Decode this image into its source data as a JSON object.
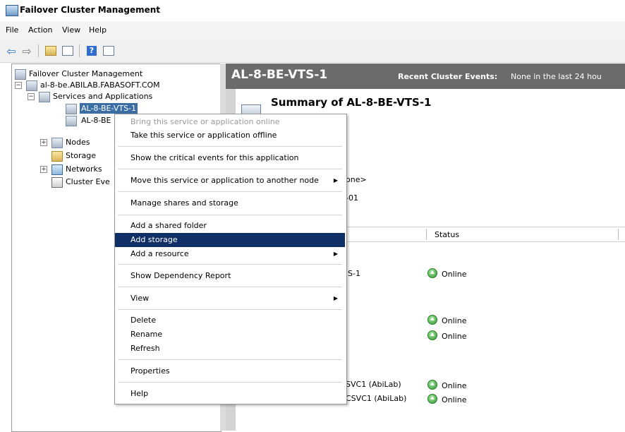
{
  "window": {
    "title": "Failover Cluster Management"
  },
  "menubar": [
    "File",
    "Action",
    "View",
    "Help"
  ],
  "toolbar": {
    "icons": [
      "back-icon",
      "forward-icon",
      "up-icon",
      "show-hide-tree-icon",
      "help-icon",
      "properties-icon"
    ]
  },
  "tree": {
    "root": "Failover Cluster Management",
    "cluster": "al-8-be.ABILAB.FABASOFT.COM",
    "services": "Services and Applications",
    "service_1": "AL-8-BE-VTS-1",
    "service_2": "AL-8-BE",
    "nodes": "Nodes",
    "storage": "Storage",
    "networks": "Networks",
    "events": "Cluster Eve"
  },
  "right": {
    "header_title": "AL-8-BE-VTS-1",
    "recent_label": "Recent Cluster Events:",
    "recent_value": "None in the last 24 hou",
    "summary_title": "Summary of AL-8-BE-VTS-1",
    "frag_none": "one>",
    "frag_01": "-01",
    "col_status": "Status",
    "row1_name": "'S-1",
    "row1_status": "Online",
    "row2_status": "Online",
    "row3_status": "Online",
    "row4_name": "SVC1 (AbiLab)",
    "row4_status": "Online",
    "row5_name": "CSVC1 (AbiLab)",
    "row5_status": "Online"
  },
  "context_menu": [
    {
      "label": "Bring this service or application online",
      "disabled": true
    },
    {
      "label": "Take this service or application offline"
    },
    {
      "label": "Show the critical events for this application"
    },
    {
      "label": "Move this service or application to another node",
      "submenu": true
    },
    {
      "label": "Manage shares and storage"
    },
    {
      "label": "Add a shared folder"
    },
    {
      "label": "Add storage",
      "highlighted": true
    },
    {
      "label": "Add a resource",
      "submenu": true
    },
    {
      "label": "Show Dependency Report"
    },
    {
      "label": "View",
      "submenu": true
    },
    {
      "label": "Delete"
    },
    {
      "label": "Rename"
    },
    {
      "label": "Refresh"
    },
    {
      "label": "Properties"
    },
    {
      "label": "Help"
    }
  ]
}
